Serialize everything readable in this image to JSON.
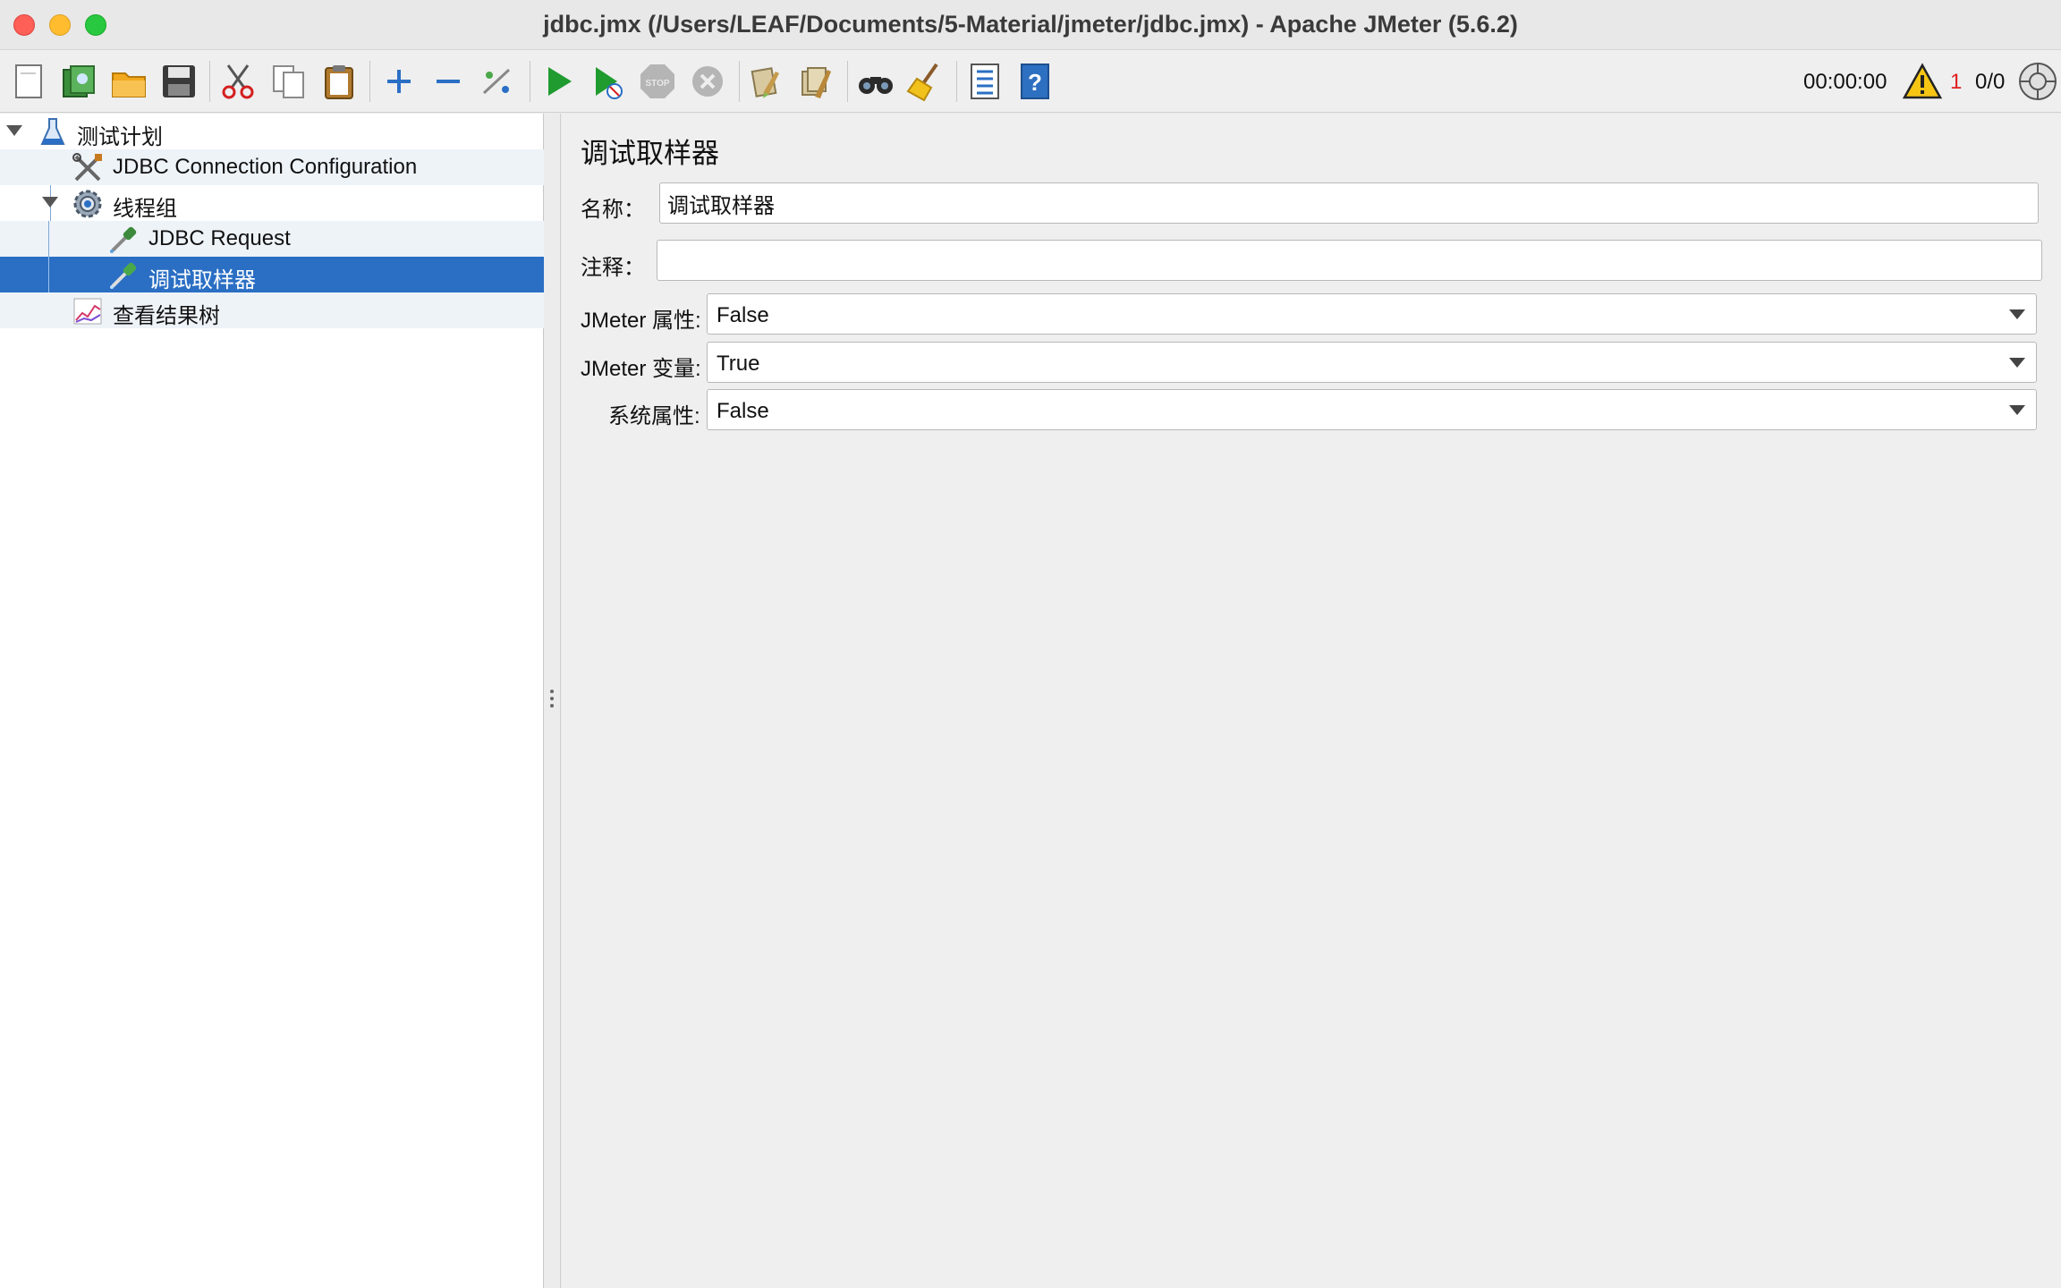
{
  "window": {
    "title": "jdbc.jmx (/Users/LEAF/Documents/5-Material/jmeter/jdbc.jmx) - Apache JMeter (5.6.2)"
  },
  "toolbar": {
    "buttons": [
      "new-icon",
      "templates-icon",
      "open-icon",
      "save-icon",
      "cut-icon",
      "copy-icon",
      "paste-icon",
      "expand-icon",
      "collapse-icon",
      "toggle-icon",
      "start-icon",
      "start-no-pauses-icon",
      "stop-icon",
      "shutdown-icon",
      "clear-icon",
      "clear-all-icon",
      "search-icon",
      "reset-search-icon",
      "function-helper-icon",
      "help-icon"
    ],
    "timer": "00:00:00",
    "warning_count": "1",
    "threads": "0/0"
  },
  "tree": {
    "items": [
      {
        "label": "测试计划",
        "icon": "test-plan-icon",
        "expanded": true
      },
      {
        "label": "JDBC Connection Configuration",
        "icon": "config-tools-icon"
      },
      {
        "label": "线程组",
        "icon": "thread-group-gear-icon",
        "expanded": true
      },
      {
        "label": "JDBC Request",
        "icon": "sampler-pipette-icon"
      },
      {
        "label": "调试取样器",
        "icon": "sampler-pipette-icon",
        "selected": true
      },
      {
        "label": "查看结果树",
        "icon": "listener-graph-icon"
      }
    ]
  },
  "panel": {
    "title": "调试取样器",
    "name_label": "名称：",
    "name_value": "调试取样器",
    "comment_label": "注释：",
    "comment_value": "",
    "jmeter_props_label": "JMeter 属性:",
    "jmeter_props_value": "False",
    "jmeter_vars_label": "JMeter 变量:",
    "jmeter_vars_value": "True",
    "system_props_label": "系统属性:",
    "system_props_value": "False"
  },
  "colors": {
    "selection": "#2a6fc4",
    "warning_count": "#e02020"
  }
}
